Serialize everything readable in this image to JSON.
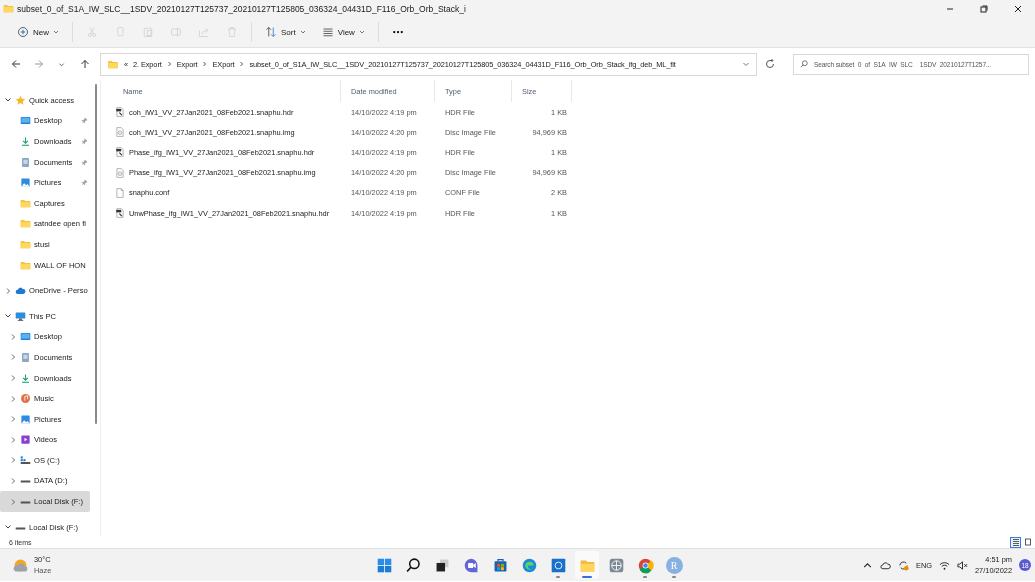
{
  "window": {
    "title": "subset_0_of_S1A_IW_SLC__1SDV_20210127T125737_20210127T125805_036324_04431D_F116_Orb_Orb_Stack_i"
  },
  "toolbar": [
    {
      "kind": "new",
      "label": "New",
      "disabled": false
    },
    {
      "kind": "cut",
      "disabled": true
    },
    {
      "kind": "copy",
      "disabled": true
    },
    {
      "kind": "paste",
      "disabled": true
    },
    {
      "kind": "rename",
      "disabled": true
    },
    {
      "kind": "share",
      "disabled": true
    },
    {
      "kind": "delete",
      "disabled": true
    },
    {
      "kind": "sort",
      "label": "Sort",
      "disabled": false
    },
    {
      "kind": "view",
      "label": "View",
      "disabled": false
    },
    {
      "kind": "more",
      "disabled": false
    }
  ],
  "address": {
    "overflow": "«",
    "path": [
      "2. Export",
      "Export",
      "EXport",
      "subset_0_of_S1A_IW_SLC__1SDV_20210127T125737_20210127T125805_036324_04431D_F116_Orb_Orb_Stack_ifg_deb_ML_flt"
    ]
  },
  "search": {
    "placeholder": "Search subset_0_of_S1A_IW_SLC__1SDV_20210127T1257..."
  },
  "sidebar": {
    "items": [
      {
        "label": "Quick access",
        "kind": "star",
        "expanded": true,
        "selected": false,
        "children": [
          {
            "label": "Desktop",
            "kind": "desktop",
            "pinned": true,
            "selected": false
          },
          {
            "label": "Downloads",
            "kind": "downloads",
            "pinned": true,
            "selected": false
          },
          {
            "label": "Documents",
            "kind": "documents",
            "pinned": true,
            "selected": false
          },
          {
            "label": "Pictures",
            "kind": "pictures",
            "pinned": true,
            "selected": false
          },
          {
            "label": "Captures",
            "kind": "folder",
            "pinned": false,
            "selected": false
          },
          {
            "label": "satndee open fi",
            "kind": "folder",
            "pinned": false,
            "selected": false
          },
          {
            "label": "stusi",
            "kind": "folder",
            "pinned": false,
            "selected": false
          },
          {
            "label": "WALL OF HON",
            "kind": "folder",
            "pinned": false,
            "selected": false
          }
        ]
      },
      {
        "label": "OneDrive - Perso",
        "kind": "cloud",
        "expanded": false,
        "selected": false
      },
      {
        "label": "This PC",
        "kind": "pc",
        "expanded": true,
        "selected": false,
        "children": [
          {
            "label": "Desktop",
            "kind": "desktop",
            "expanded": false,
            "selected": false
          },
          {
            "label": "Documents",
            "kind": "documents",
            "expanded": false,
            "selected": false
          },
          {
            "label": "Downloads",
            "kind": "downloads",
            "expanded": false,
            "selected": false
          },
          {
            "label": "Music",
            "kind": "music",
            "expanded": false,
            "selected": false
          },
          {
            "label": "Pictures",
            "kind": "pictures",
            "expanded": false,
            "selected": false
          },
          {
            "label": "Videos",
            "kind": "videos",
            "expanded": false,
            "selected": false
          },
          {
            "label": "OS (C:)",
            "kind": "osdrive",
            "expanded": false,
            "selected": false
          },
          {
            "label": "DATA (D:)",
            "kind": "drive",
            "expanded": false,
            "selected": false
          },
          {
            "label": "Local Disk (F:)",
            "kind": "drive",
            "expanded": false,
            "selected": true
          }
        ]
      },
      {
        "label": "Local Disk (F:)",
        "kind": "drive",
        "expanded": true,
        "selected": false
      }
    ]
  },
  "table": {
    "columns": [
      "Name",
      "Date modified",
      "Type",
      "Size"
    ],
    "rows": [
      {
        "kind": "hdr",
        "name": "coh_IW1_VV_27Jan2021_08Feb2021.snaphu.hdr",
        "date": "14/10/2022 4:19 pm",
        "type": "HDR File",
        "size": "1 KB"
      },
      {
        "kind": "img",
        "name": "coh_IW1_VV_27Jan2021_08Feb2021.snaphu.img",
        "date": "14/10/2022 4:20 pm",
        "type": "Disc Image File",
        "size": "94,969 KB"
      },
      {
        "kind": "hdr",
        "name": "Phase_ifg_IW1_VV_27Jan2021_08Feb2021.snaphu.hdr",
        "date": "14/10/2022 4:19 pm",
        "type": "HDR File",
        "size": "1 KB"
      },
      {
        "kind": "img",
        "name": "Phase_ifg_IW1_VV_27Jan2021_08Feb2021.snaphu.img",
        "date": "14/10/2022 4:20 pm",
        "type": "Disc Image File",
        "size": "94,969 KB"
      },
      {
        "kind": "conf",
        "name": "snaphu.conf",
        "date": "14/10/2022 4:19 pm",
        "type": "CONF File",
        "size": "2 KB"
      },
      {
        "kind": "hdr",
        "name": "UnwPhase_ifg_IW1_VV_27Jan2021_08Feb2021.snaphu.hdr",
        "date": "14/10/2022 4:19 pm",
        "type": "HDR File",
        "size": "1 KB"
      }
    ]
  },
  "status_bar": {
    "count": "6 items",
    "views": [
      {
        "kind": "details",
        "selected": true
      },
      {
        "kind": "tiles",
        "selected": false
      }
    ]
  },
  "taskbar": {
    "weather": {
      "temp": "30°C",
      "condition": "Haze"
    },
    "apps": [
      {
        "kind": "start",
        "running": false
      },
      {
        "kind": "search",
        "running": false
      },
      {
        "kind": "taskview",
        "running": false
      },
      {
        "kind": "chat",
        "running": false
      },
      {
        "kind": "store",
        "running": false
      },
      {
        "kind": "edge",
        "running": false
      },
      {
        "kind": "bluebox",
        "running": true,
        "active": false
      },
      {
        "kind": "explorer",
        "running": true,
        "active": true
      },
      {
        "kind": "globe",
        "running": false
      },
      {
        "kind": "chrome",
        "running": true,
        "active": false
      },
      {
        "kind": "r",
        "label": "R",
        "running": true,
        "active": false
      }
    ],
    "language": "ENG",
    "time": "4:51 pm",
    "date": "27/10/2022",
    "notifications": "18"
  }
}
